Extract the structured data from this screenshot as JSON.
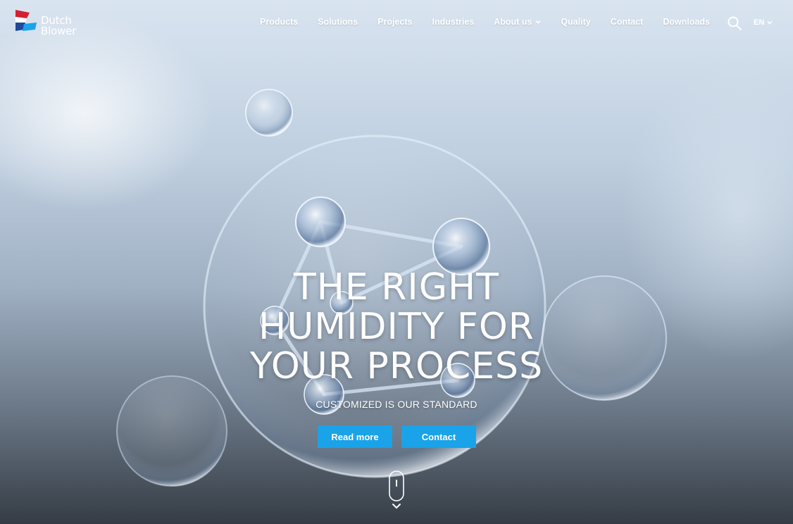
{
  "brand": {
    "name_line1": "Dutch",
    "name_line2": "Blower",
    "flag_colors": [
      "#d42030",
      "#ffffff",
      "#1f4a9a",
      "#1aa3e8"
    ]
  },
  "nav": {
    "items": [
      {
        "label": "Products"
      },
      {
        "label": "Solutions"
      },
      {
        "label": "Projects"
      },
      {
        "label": "Industries"
      },
      {
        "label": "About us",
        "has_dropdown": true
      },
      {
        "label": "Quality"
      },
      {
        "label": "Contact"
      },
      {
        "label": "Downloads"
      }
    ],
    "search_icon": "search-icon",
    "language": "EN"
  },
  "hero": {
    "headline_line1": "THE RIGHT",
    "headline_line2": "HUMIDITY FOR",
    "headline_line3": "YOUR PROCESS",
    "subheadline": "CUSTOMIZED IS OUR STANDARD",
    "primary_button": "Read more",
    "secondary_button": "Contact",
    "scroll_icon": "mouse-scroll-icon"
  },
  "colors": {
    "accent": "#1aa3e8",
    "text_on_hero": "#ffffff"
  }
}
